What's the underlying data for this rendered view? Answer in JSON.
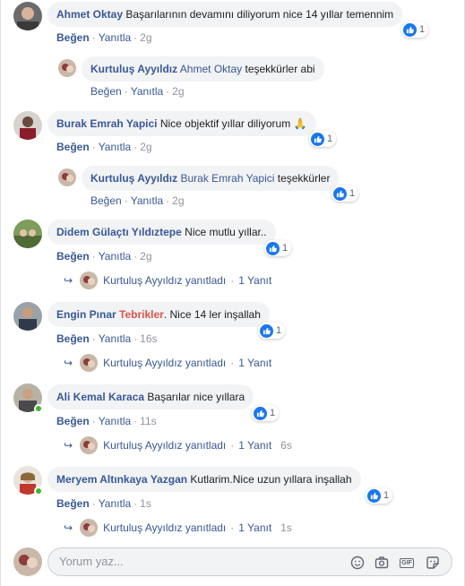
{
  "comments": [
    {
      "author": "Ahmet Oktay",
      "text": "Başarılarının devamını diliyorum nice 14 yıllar temennim",
      "likes": "1",
      "like_label": "Beğen",
      "reply_label": "Yanıtla",
      "time": "2g"
    },
    {
      "author": "Burak Emrah Yapici",
      "text": "Nice objektif yıllar diliyorum 🙏",
      "likes": "1",
      "like_label": "Beğen",
      "reply_label": "Yanıtla",
      "time": "2g"
    },
    {
      "author": "Didem Gülaçtı Yıldıztepe",
      "text": "Nice mutlu yıllar..",
      "likes": "1",
      "like_label": "Beğen",
      "reply_label": "Yanıtla",
      "time": "2g"
    },
    {
      "author": "Engin Pınar",
      "highlight": "Tebrikler",
      "text": ". Nice 14 ler inşallah",
      "likes": "1",
      "like_label": "Beğen",
      "reply_label": "Yanıtla",
      "time": "16s"
    },
    {
      "author": "Ali Kemal Karaca",
      "text": "Başarılar nice yıllara",
      "likes": "1",
      "like_label": "Beğen",
      "reply_label": "Yanıtla",
      "time": "11s"
    },
    {
      "author": "Meryem Altınkaya Yazgan",
      "text": "Kutlarim.Nice uzun yıllara inşallah",
      "likes": "1",
      "like_label": "Beğen",
      "reply_label": "Yanıtla",
      "time": "1s"
    }
  ],
  "replies": [
    {
      "author": "Kurtuluş Ayyıldız",
      "mention": "Ahmet Oktay",
      "text": "teşekkürler abi",
      "likes": "",
      "like_label": "Beğen",
      "reply_label": "Yanıtla",
      "time": "2g"
    },
    {
      "author": "Kurtuluş Ayyıldız",
      "mention": "Burak Emrah Yapici",
      "text": "teşekkürler",
      "likes": "1",
      "like_label": "Beğen",
      "reply_label": "Yanıtla",
      "time": "2g"
    }
  ],
  "reply_summaries": [
    {
      "name": "Kurtuluş Ayyıldız yanıtladı",
      "count": "1 Yanıt",
      "time": ""
    },
    {
      "name": "Kurtuluş Ayyıldız yanıtladı",
      "count": "1 Yanıt",
      "time": ""
    },
    {
      "name": "Kurtuluş Ayyıldız yanıtladı",
      "count": "1 Yanıt",
      "time": "6s"
    },
    {
      "name": "Kurtuluş Ayyıldız yanıtladı",
      "count": "1 Yanıt",
      "time": "1s"
    }
  ],
  "composer": {
    "placeholder": "Yorum yaz..."
  },
  "icons": {
    "like": "thumbs-up-icon",
    "reply_arrow": "reply-arrow-icon",
    "emoji": "emoji-icon",
    "camera": "camera-icon",
    "gif": "gif-icon",
    "sticker": "sticker-icon"
  },
  "colors": {
    "link": "#385898",
    "like_blue": "#1877f2",
    "bubble": "#f2f3f5",
    "online": "#42b72a",
    "highlight": "#e0544a"
  }
}
